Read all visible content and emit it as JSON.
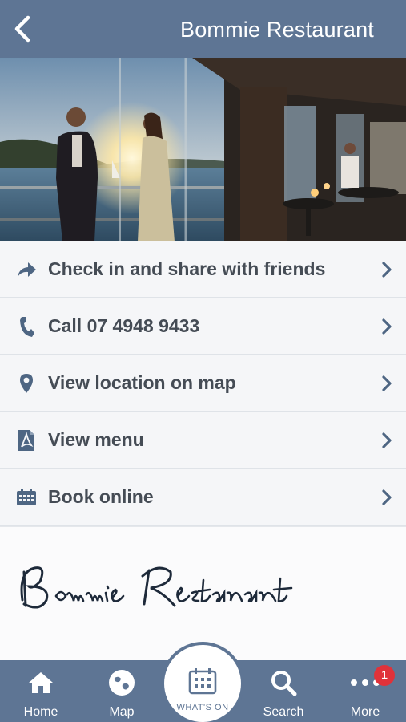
{
  "header": {
    "title": "Bommie Restaurant",
    "back_icon": "chevron-left-icon"
  },
  "hero": {
    "image": "photo of couple on balcony at sunset with restaurant dining tables"
  },
  "actions": [
    {
      "icon": "share-arrow-icon",
      "label": "Check in and share with friends"
    },
    {
      "icon": "phone-icon",
      "label": "Call 07 4948 9433"
    },
    {
      "icon": "map-pin-icon",
      "label": "View location on map"
    },
    {
      "icon": "pdf-icon",
      "label": "View menu"
    },
    {
      "icon": "calendar-icon",
      "label": "Book online"
    }
  ],
  "content": {
    "heading": "Bommie Restaurant"
  },
  "tabbar": {
    "home": "Home",
    "map": "Map",
    "whats_on": "WHAT'S ON",
    "search": "Search",
    "more": "More",
    "more_badge": "1"
  },
  "colors": {
    "header_bg": "#5e7594",
    "row_text": "#454c55",
    "icon": "#4e6683",
    "badge": "#e0323a"
  }
}
